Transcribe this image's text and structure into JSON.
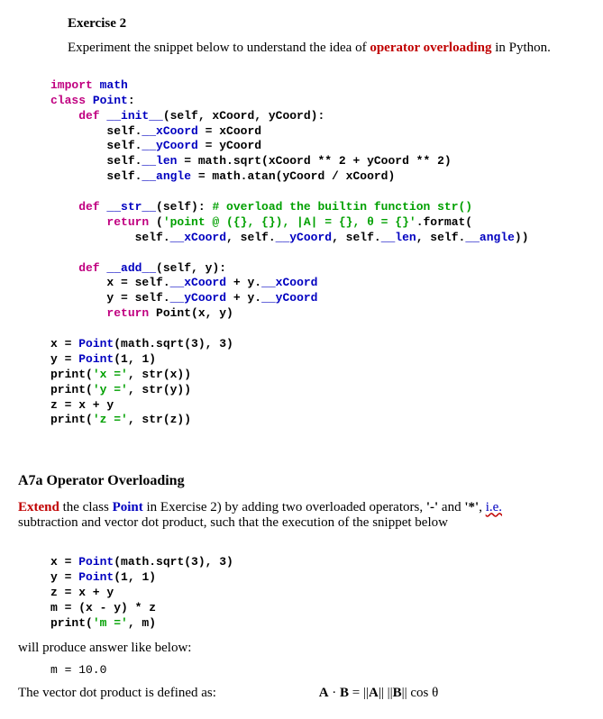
{
  "exercise": {
    "title": "Exercise 2",
    "intro_pre": "Experiment the snippet below to understand the idea of ",
    "intro_red": "operator overloading",
    "intro_post": " in Python."
  },
  "code1": {
    "l1a": "import",
    "l1b": " math",
    "l2a": "class",
    "l2b": " Point",
    "l2c": ":",
    "l3a": "    def",
    "l3b": " __init__",
    "l3c": "(self, xCoord, yCoord):",
    "l4a": "        self.",
    "l4b": "__xCoord",
    "l4c": " = xCoord",
    "l5a": "        self.",
    "l5b": "__yCoord",
    "l5c": " = yCoord",
    "l6a": "        self.",
    "l6b": "__len",
    "l6c": " = math.sqrt(xCoord ** 2 + yCoord ** 2)",
    "l7a": "        self.",
    "l7b": "__angle",
    "l7c": " = math.atan(yCoord / xCoord)",
    "l8": " ",
    "l9a": "    def",
    "l9b": " __str__",
    "l9c": "(self): ",
    "l9d": "# overload the builtin function str()",
    "l10a": "        return",
    "l10b": " (",
    "l10c": "'point @ ({}, {}), |A| = {}, θ = {}'",
    "l10d": ".format(",
    "l11a": "            self.",
    "l11b": "__xCoord",
    "l11c": ", self.",
    "l11d": "__yCoord",
    "l11e": ", self.",
    "l11f": "__len",
    "l11g": ", self.",
    "l11h": "__angle",
    "l11i": "))",
    "l12": " ",
    "l13a": "    def",
    "l13b": " __add__",
    "l13c": "(self, y):",
    "l14a": "        x = self.",
    "l14b": "__xCoord",
    "l14c": " + y.",
    "l14d": "__xCoord",
    "l15a": "        y = self.",
    "l15b": "__yCoord",
    "l15c": " + y.",
    "l15d": "__yCoord",
    "l16a": "        return",
    "l16b": " Point(x, y)",
    "l17": " ",
    "l18a": "x = ",
    "l18b": "Point",
    "l18c": "(math.sqrt(3), 3)",
    "l19a": "y = ",
    "l19b": "Point",
    "l19c": "(1, 1)",
    "l20a": "print(",
    "l20b": "'x ='",
    "l20c": ", str(x))",
    "l21a": "print(",
    "l21b": "'y ='",
    "l21c": ", str(y))",
    "l22": "z = x + y",
    "l23a": "print(",
    "l23b": "'z ='",
    "l23c": ", str(z))"
  },
  "section": {
    "title": "A7a    Operator Overloading"
  },
  "extend": {
    "p1a": "Extend",
    "p1b": " the class ",
    "p1c": "Point",
    "p1d": " in Exercise 2) by adding two overloaded operators, ",
    "p1e": "'-'",
    "p1f": " and ",
    "p1g": "'*'",
    "p1h": ", ",
    "p1i": "i.e.",
    "p2": "subtraction and vector dot product, such that the execution of the snippet below"
  },
  "code2": {
    "l1a": "x = ",
    "l1b": "Point",
    "l1c": "(math.sqrt(3), 3)",
    "l2a": "y = ",
    "l2b": "Point",
    "l2c": "(1, 1)",
    "l3": "z = x + y",
    "l4": "m = (x - y) * z",
    "l5a": "print(",
    "l5b": "'m ='",
    "l5c": ", m)"
  },
  "below": {
    "text": "will produce answer like below:",
    "result": "m = 10.0"
  },
  "dotproduct": {
    "text": "The vector dot product is defined as:",
    "formula_a": "A",
    "formula_dot": " · ",
    "formula_b": "B",
    "formula_eq": " = ||",
    "formula_a2": "A",
    "formula_mid": "|| ||",
    "formula_b2": "B",
    "formula_end": "|| cos θ"
  }
}
